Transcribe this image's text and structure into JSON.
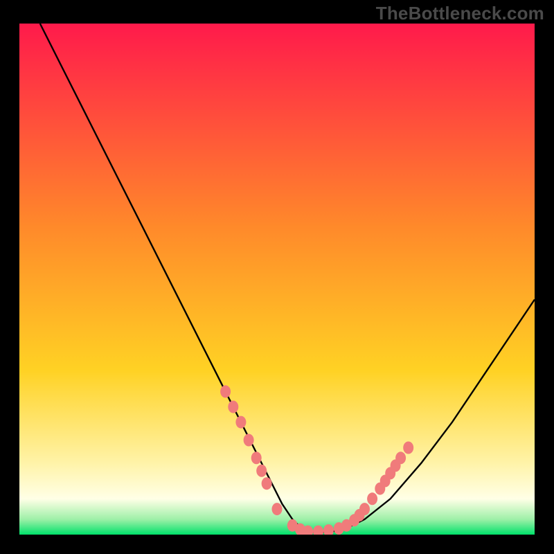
{
  "watermark": "TheBottleneck.com",
  "colors": {
    "page_bg": "#000000",
    "watermark": "#4a4a4a",
    "curve": "#000000",
    "marker_fill": "#f07b7b",
    "marker_stroke": "#c94f4f",
    "gradient_top": "#ff1a4b",
    "gradient_mid1": "#ff6a3a",
    "gradient_mid2": "#ffd224",
    "gradient_mid3": "#fff7c7",
    "gradient_bottom": "#00e16a"
  },
  "chart_data": {
    "type": "line",
    "title": "",
    "xlabel": "",
    "ylabel": "",
    "xlim": [
      0,
      100
    ],
    "ylim": [
      0,
      100
    ],
    "grid": false,
    "legend": false,
    "series": [
      {
        "name": "curve",
        "x": [
          4,
          8,
          12,
          16,
          20,
          24,
          28,
          32,
          36,
          40,
          44,
          48,
          51,
          53,
          55,
          57,
          60,
          63,
          67,
          72,
          78,
          84,
          90,
          96,
          100
        ],
        "y": [
          100,
          92,
          84,
          76,
          68,
          60,
          52,
          44,
          36,
          28,
          20,
          12,
          6,
          3,
          1,
          0.5,
          0.5,
          1,
          3,
          7,
          14,
          22,
          31,
          40,
          46
        ]
      }
    ],
    "markers": [
      {
        "x": 40,
        "y": 28
      },
      {
        "x": 41.5,
        "y": 25
      },
      {
        "x": 43,
        "y": 22
      },
      {
        "x": 44.5,
        "y": 18.5
      },
      {
        "x": 46,
        "y": 15
      },
      {
        "x": 47,
        "y": 12.5
      },
      {
        "x": 48,
        "y": 10
      },
      {
        "x": 50,
        "y": 5
      },
      {
        "x": 53,
        "y": 1.8
      },
      {
        "x": 54.5,
        "y": 1
      },
      {
        "x": 56,
        "y": 0.6
      },
      {
        "x": 58,
        "y": 0.6
      },
      {
        "x": 60,
        "y": 0.8
      },
      {
        "x": 62,
        "y": 1.2
      },
      {
        "x": 63.5,
        "y": 1.8
      },
      {
        "x": 65,
        "y": 2.8
      },
      {
        "x": 66,
        "y": 3.8
      },
      {
        "x": 67,
        "y": 5
      },
      {
        "x": 68.5,
        "y": 7
      },
      {
        "x": 70,
        "y": 9
      },
      {
        "x": 71,
        "y": 10.5
      },
      {
        "x": 72,
        "y": 12
      },
      {
        "x": 73,
        "y": 13.5
      },
      {
        "x": 74,
        "y": 15
      },
      {
        "x": 75.5,
        "y": 17
      }
    ]
  }
}
